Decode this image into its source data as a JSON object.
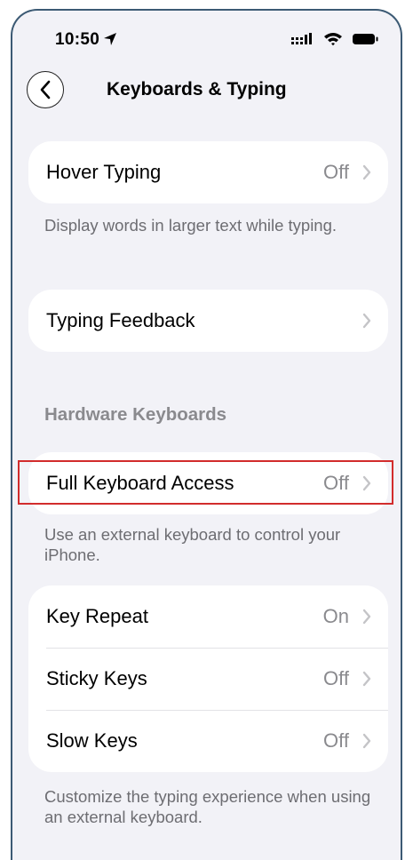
{
  "status_bar": {
    "time": "10:50",
    "icons": [
      "location-arrow-icon",
      "cellular-signal-icon",
      "wifi-icon",
      "battery-icon"
    ]
  },
  "nav": {
    "title": "Keyboards & Typing",
    "back_icon": "chevron-left-icon"
  },
  "hover_typing": {
    "label": "Hover Typing",
    "value": "Off",
    "footnote": "Display words in larger text while typing."
  },
  "typing_feedback": {
    "label": "Typing Feedback"
  },
  "hardware": {
    "header": "Hardware Keyboards",
    "full_access": {
      "label": "Full Keyboard Access",
      "value": "Off"
    },
    "footnote": "Use an external keyboard to control your iPhone.",
    "rows": [
      {
        "label": "Key Repeat",
        "value": "On"
      },
      {
        "label": "Sticky Keys",
        "value": "Off"
      },
      {
        "label": "Slow Keys",
        "value": "Off"
      }
    ],
    "rows_footnote": "Customize the typing experience when using an external keyboard."
  },
  "colors": {
    "background": "#f2f2f7",
    "highlight_box": "#d22c2c",
    "secondary_text": "#8a8a8e"
  }
}
